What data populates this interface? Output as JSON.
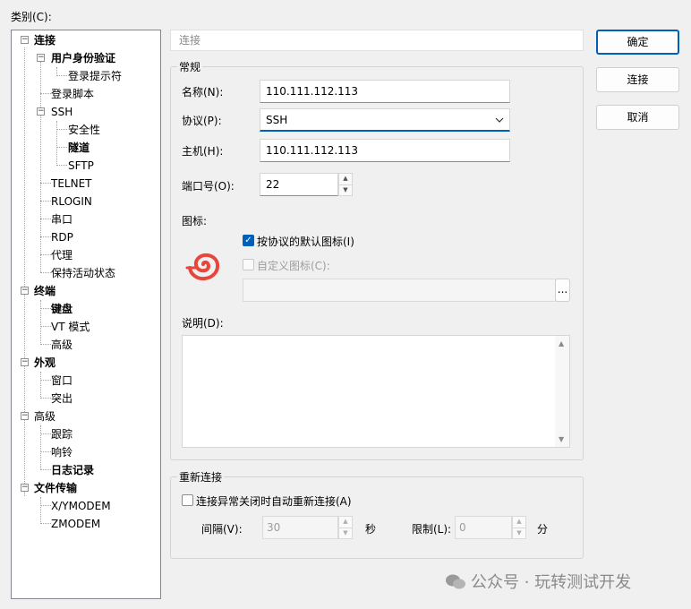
{
  "category_label": "类别(C):",
  "tree": {
    "nodes": [
      {
        "label": "连接",
        "bold": true
      },
      {
        "label": "用户身份验证",
        "bold": true
      },
      {
        "label": "登录提示符",
        "bold": false
      },
      {
        "label": "登录脚本",
        "bold": false
      },
      {
        "label": "SSH",
        "bold": false
      },
      {
        "label": "安全性",
        "bold": false
      },
      {
        "label": "隧道",
        "bold": true
      },
      {
        "label": "SFTP",
        "bold": false
      },
      {
        "label": "TELNET",
        "bold": false
      },
      {
        "label": "RLOGIN",
        "bold": false
      },
      {
        "label": "串口",
        "bold": false
      },
      {
        "label": "RDP",
        "bold": false
      },
      {
        "label": "代理",
        "bold": false
      },
      {
        "label": "保持活动状态",
        "bold": false
      },
      {
        "label": "终端",
        "bold": true
      },
      {
        "label": "键盘",
        "bold": true
      },
      {
        "label": "VT 模式",
        "bold": false
      },
      {
        "label": "高级",
        "bold": false
      },
      {
        "label": "外观",
        "bold": true
      },
      {
        "label": "窗口",
        "bold": false
      },
      {
        "label": "突出",
        "bold": false
      },
      {
        "label": "高级",
        "bold": false
      },
      {
        "label": "跟踪",
        "bold": false
      },
      {
        "label": "响铃",
        "bold": false
      },
      {
        "label": "日志记录",
        "bold": true
      },
      {
        "label": "文件传输",
        "bold": true
      },
      {
        "label": "X/YMODEM",
        "bold": false
      },
      {
        "label": "ZMODEM",
        "bold": false
      }
    ]
  },
  "header_title": "连接",
  "general": {
    "legend": "常规",
    "name_label": "名称(N):",
    "name_value": "110.111.112.113",
    "protocol_label": "协议(P):",
    "protocol_value": "SSH",
    "host_label": "主机(H):",
    "host_value": "110.111.112.113",
    "port_label": "端口号(O):",
    "port_value": "22",
    "icon_label": "图标:",
    "default_icon_label": "按协议的默认图标(I)",
    "custom_icon_label": "自定义图标(C):",
    "browse_label": "...",
    "desc_label": "说明(D):"
  },
  "reconnect": {
    "legend": "重新连接",
    "auto_label": "连接异常关闭时自动重新连接(A)",
    "interval_label": "间隔(V):",
    "interval_value": "30",
    "interval_unit": "秒",
    "limit_label": "限制(L):",
    "limit_value": "0",
    "limit_unit": "分"
  },
  "buttons": {
    "ok": "确定",
    "connect": "连接",
    "cancel": "取消"
  },
  "watermark": "公众号 · 玩转测试开发",
  "colors": {
    "accent": "#005fb8",
    "logo": "#e8453c"
  }
}
